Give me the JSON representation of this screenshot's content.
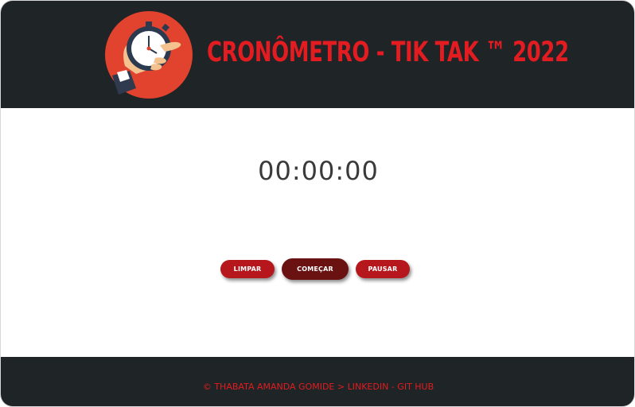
{
  "header": {
    "title": "CRONÔMETRO - TIK TAK ™ 2022",
    "logo_icon": "stopwatch-hand-icon"
  },
  "timer": {
    "display": "00:00:00"
  },
  "controls": {
    "clear_label": "Limpar",
    "start_label": "Começar",
    "pause_label": "Pausar"
  },
  "footer": {
    "copyright": "© THABATA AMANDA GOMIDE",
    "separator": ">",
    "linkedin": "LINKEDIN",
    "dash": "-",
    "github": "GIT HUB"
  },
  "colors": {
    "header_bg": "#1f2427",
    "accent_red": "#e21c20",
    "button_red": "#b6171c",
    "button_dark": "#6a1212"
  }
}
